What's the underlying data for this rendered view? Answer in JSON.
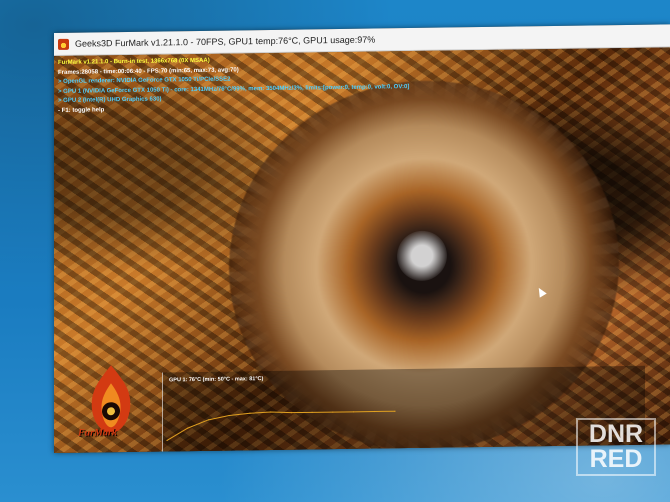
{
  "window": {
    "title": "Geeks3D FurMark v1.21.1.0 - 70FPS, GPU1 temp:76°C, GPU1 usage:97%",
    "icon": "furmark-app-icon"
  },
  "hud": {
    "lines": [
      "FurMark v1.21.1.0 - Burn-in test, 1366x768 (0X MSAA)",
      "Frames:28058 - time:00:06:40 - FPS:70 (min:65, max:73, avg:70)",
      "> OpenGL renderer: NVIDIA GeForce GTX 1050 Ti/PCIe/SSE2",
      "> GPU 1 (NVIDIA GeForce GTX 1050 Ti) - core: 1341MHz/76°C/99%, mem: 3504MHz/3%, limits:[power:0, temp:0, volt:0, OV:0]",
      "> GPU 2 (Intel(R) UHD Graphics 630)",
      "- F1: toggle help"
    ]
  },
  "graph": {
    "label": "GPU 1: 76°C (min: 50°C - max: 81°C)",
    "line_color": "#e0a020"
  },
  "chart_data": {
    "type": "line",
    "title": "GPU 1: 76°C (min: 50°C - max: 81°C)",
    "series": [
      {
        "name": "GPU 1",
        "values": [
          50,
          62,
          70,
          74,
          76,
          77,
          76,
          76,
          76,
          76,
          76,
          76
        ]
      }
    ],
    "ylim": [
      40,
      100
    ]
  },
  "logo": {
    "text": "FurMark"
  },
  "watermark": {
    "line1": "DNR",
    "line2": "RED"
  },
  "colors": {
    "desktop": "#1a7cc0",
    "hud_yellow": "#ffff40",
    "hud_cyan": "#4fd0ff",
    "logo_red": "#d33a12"
  }
}
